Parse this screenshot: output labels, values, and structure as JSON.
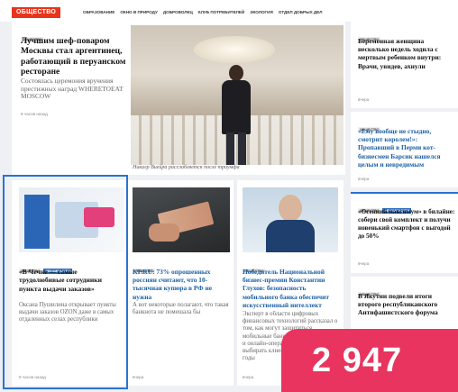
{
  "section": "ОБЩЕСТВО",
  "nav": [
    "ОБРАЗОВАНИЕ",
    "ОКНО В ПРИРОДУ",
    "ДОБРОВОЛЕЦ",
    "КЛУБ ПОТРЕБИТЕЛЕЙ",
    "ЭКОЛОГИЯ",
    "ОТДЕЛ ДОБРЫХ ДЕЛ"
  ],
  "main": {
    "badge": "ОБЩЕСТВО",
    "title": "Лучшим шеф-поваром Москвы стал аргентинец, работающий в перуанском ресторане",
    "desc": "Состоялась церемония вручения престижных наград WHERETOEAT MOSCOW",
    "time": "8 часов назад",
    "caption": "Никалр Виейра расслабляется после триумфа"
  },
  "cards": [
    {
      "badges": [
        "ОБЩЕСТВО",
        "РЕКОМЕНДУЕМ"
      ],
      "title": "«В Чечне — самые трудолюбивые сотрудники пункта выдачи заказов»",
      "desc": "Оксана Пушилина открывает пункты выдачи заказов OZON даже в самых отдаленных селах республики",
      "time": "9 часов назад"
    },
    {
      "badges": [
        "ОБЩЕСТВО"
      ],
      "title": "KP.RU: 73% опрошенных россиян считают, что 10-тысячная купюра в РФ не нужна",
      "desc": "А вот некоторые полагают, что такая банкнота не помешала бы",
      "time": "вчера"
    },
    {
      "badges": [
        "ОБЩЕСТВО"
      ],
      "title": "Победитель Национальной бизнес-премии Константин Глухов: безопасность мобильного банка обеспечит искусственный интеллект",
      "desc": "Эксперт в области цифровых финансовых технологий рассказал о том, как могут защититься мобильные банковские приложения и онлайн-операциями стоит выбирать клиенты в ближайшие годы",
      "time": "вчера"
    }
  ],
  "right": [
    {
      "badges": [
        "ОБЩЕСТВО"
      ],
      "title": "Беременная женщина несколько недель ходила с мертвым ребенком внутри: Врачи, увидев, ахнули",
      "time": "вчера"
    },
    {
      "badges": [
        "ОБЩЕСТВО"
      ],
      "title": "«Ему вообще не стыдно, смотрит королем!»: Пропавший в Перми кот-бизнесмен Барсик нашелся целым и невредимым",
      "time": "вчера"
    },
    {
      "badges": [
        "ОБЩЕСТВО",
        "РЕКОМЕНДУЕМ"
      ],
      "title": "«Осенний максимум» в билайне: собери свой комплект и получи новенький смартфон с выгодой до 50%",
      "time": "вчера"
    },
    {
      "badges": [
        "ОБЩЕСТВО"
      ],
      "title": "В Якутии подвели итоги второго республиканского Антифашистского форума",
      "time": ""
    }
  ],
  "counter": "2 947",
  "colors": {
    "accent": "#e8341c",
    "link": "#1a5fa8",
    "badge_blue": "#2a6bbd",
    "counter_bg": "#e8345e"
  }
}
